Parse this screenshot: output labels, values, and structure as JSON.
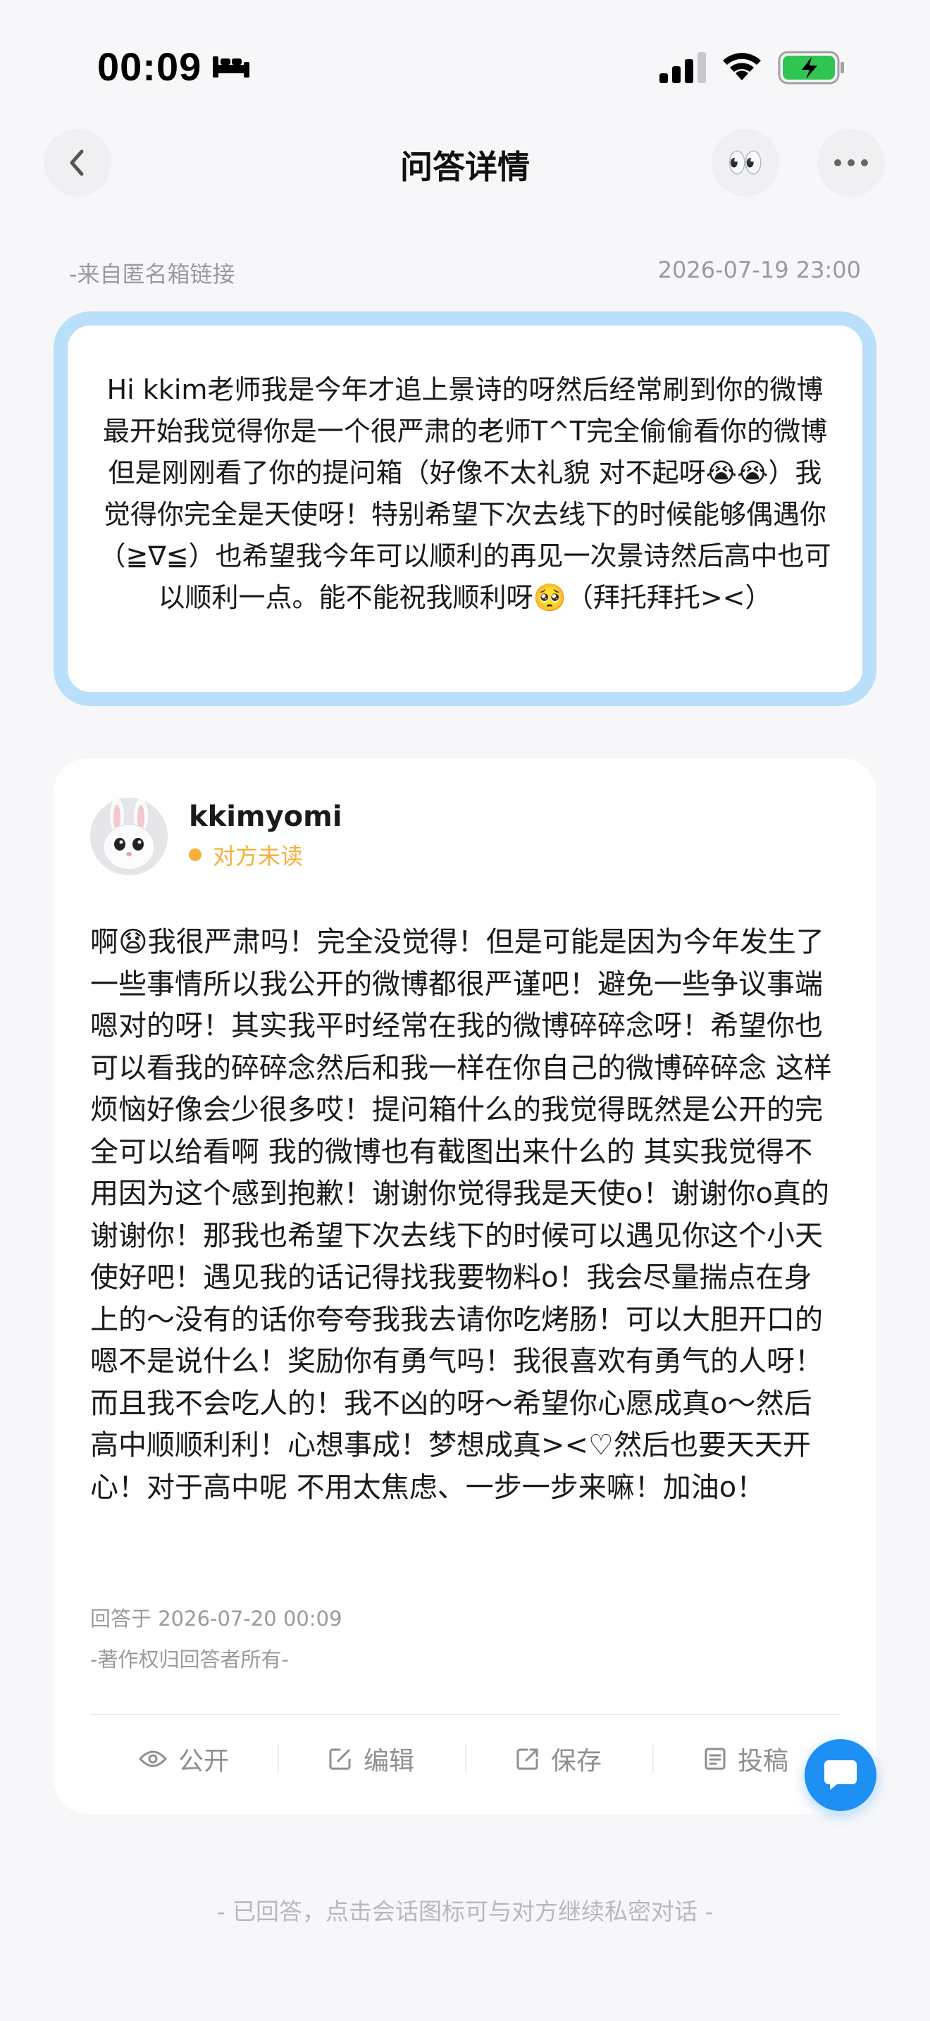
{
  "status_bar": {
    "time": "00:09",
    "icons": [
      "bed-icon",
      "cellular-signal-icon",
      "wifi-icon",
      "battery-charging-icon"
    ]
  },
  "nav": {
    "title": "问答详情",
    "left_icon": "chevron-left-icon",
    "right_icons": [
      "eyes-icon",
      "more-icon"
    ],
    "eyes_emoji": "👀"
  },
  "question": {
    "source": "-来自匿名箱链接",
    "datetime": "2026-07-19 23:00",
    "text": "Hi kkim老师我是今年才追上景诗的呀然后经常刷到你的微博最开始我觉得你是一个很严肃的老师T^T完全偷偷看你的微博 但是刚刚看了你的提问箱（好像不太礼貌 对不起呀😭😭）我觉得你完全是天使呀！特别希望下次去线下的时候能够偶遇你（≧∇≦）也希望我今年可以顺利的再见一次景诗然后高中也可以顺利一点。能不能祝我顺利呀🥺（拜托拜托><）",
    "border_color": "#b9dffb"
  },
  "answer": {
    "username": "kkimyomi",
    "read_status": "对方未读",
    "status_color": "#f5b13c",
    "text": "啊😧我很严肃吗！完全没觉得！但是可能是因为今年发生了一些事情所以我公开的微博都很严谨吧！避免一些争议事端嗯对的呀！其实我平时经常在我的微博碎碎念呀！希望你也可以看我的碎碎念然后和我一样在你自己的微博碎碎念 这样烦恼好像会少很多哎！提问箱什么的我觉得既然是公开的完全可以给看啊 我的微博也有截图出来什么的 其实我觉得不用因为这个感到抱歉！谢谢你觉得我是天使o！谢谢你o真的谢谢你！那我也希望下次去线下的时候可以遇见你这个小天使好吧！遇见我的话记得找我要物料o！我会尽量揣点在身上的～没有的话你夸夸我我去请你吃烤肠！可以大胆开口的嗯不是说什么！奖励你有勇气吗！我很喜欢有勇气的人呀！而且我不会吃人的！我不凶的呀～希望你心愿成真o～然后高中顺顺利利！心想事成！梦想成真><♡然后也要天天开心！对于高中呢 不用太焦虑、一步一步来嘛！加油o！",
    "answered_at": "回答于 2026-07-20 00:09",
    "copyright": "-著作权归回答者所有-",
    "actions": [
      {
        "label": "公开",
        "icon": "eye-icon"
      },
      {
        "label": "编辑",
        "icon": "edit-icon"
      },
      {
        "label": "保存",
        "icon": "share-out-icon"
      },
      {
        "label": "投稿",
        "icon": "submit-doc-icon"
      }
    ]
  },
  "chat_fab": {
    "icon": "chat-bubble-icon",
    "color": "#1e8ff3"
  },
  "footer_note": "- 已回答，点击会话图标可与对方继续私密对话 -"
}
